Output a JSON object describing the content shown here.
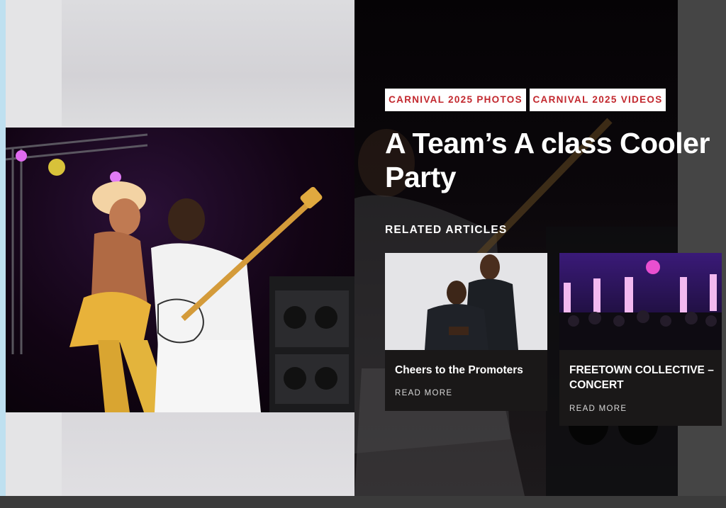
{
  "tags": {
    "photos": "CARNIVAL 2025 PHOTOS",
    "videos": "CARNIVAL 2025 VIDEOS"
  },
  "article": {
    "title": "A Team’s A class Cooler Party"
  },
  "related": {
    "heading": "RELATED ARTICLES",
    "cards": [
      {
        "title": "Cheers to the Promoters",
        "more": "READ MORE"
      },
      {
        "title": "FREETOWN COLLECTIVE – CONCERT",
        "more": "READ MORE"
      }
    ]
  },
  "colors": {
    "tag_text": "#c2272d",
    "card_bg": "#1a1818",
    "page_bg": "#3a3a3a"
  },
  "icons": {
    "hero": "concert-performers-image"
  }
}
